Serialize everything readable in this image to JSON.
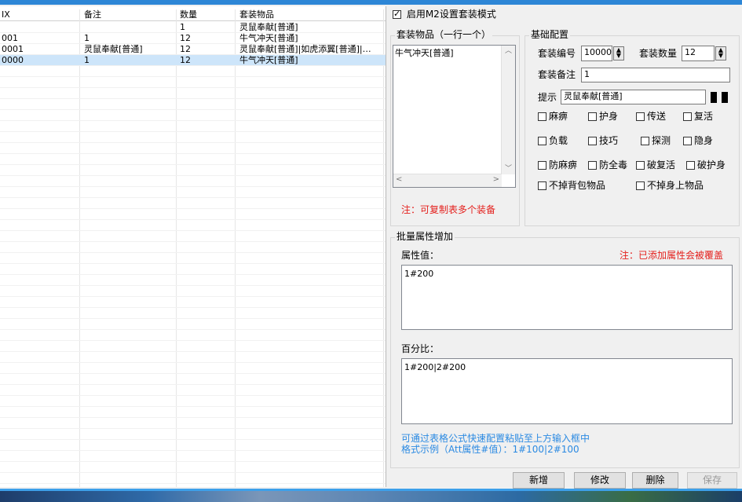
{
  "enable_mode": {
    "label": "启用M2设置套装模式",
    "checked": true
  },
  "table": {
    "columns": [
      "IX",
      "备注",
      "数量",
      "套装物品"
    ],
    "rows": [
      {
        "ix": "",
        "note": "",
        "qty": "1",
        "items": "灵鼠奉献[普通]",
        "selected": false
      },
      {
        "ix": "001",
        "note": "1",
        "qty": "12",
        "items": "牛气冲天[普通]",
        "selected": false
      },
      {
        "ix": "0001",
        "note": "灵鼠奉献[普通]",
        "qty": "12",
        "items": "灵鼠奉献[普通]|如虎添翼[普通]|…",
        "selected": false
      },
      {
        "ix": "0000",
        "note": "1",
        "qty": "12",
        "items": "牛气冲天[普通]",
        "selected": true
      }
    ]
  },
  "suit_items": {
    "legend": "套装物品（一行一个）",
    "content": "牛气冲天[普通]",
    "note": "注：可复制表多个装备"
  },
  "basic": {
    "legend": "基础配置",
    "id_label": "套装编号",
    "id_value": "10000",
    "count_label": "套装数量",
    "count_value": "12",
    "remark_label": "套装备注",
    "remark_value": "1",
    "hint_label": "提示",
    "hint_value": "灵鼠奉献[普通]",
    "options": [
      {
        "label": "麻痹",
        "checked": false
      },
      {
        "label": "护身",
        "checked": false
      },
      {
        "label": "传送",
        "checked": false
      },
      {
        "label": "复活",
        "checked": false
      },
      {
        "label": "负载",
        "checked": false
      },
      {
        "label": "技巧",
        "checked": false
      },
      {
        "label": "探测",
        "checked": false
      },
      {
        "label": "隐身",
        "checked": false
      },
      {
        "label": "防麻痹",
        "checked": false
      },
      {
        "label": "防全毒",
        "checked": false
      },
      {
        "label": "破复活",
        "checked": false
      },
      {
        "label": "破护身",
        "checked": false
      },
      {
        "label": "不掉背包物品",
        "checked": false
      },
      {
        "label": "不掉身上物品",
        "checked": false
      }
    ]
  },
  "batch": {
    "legend": "批量属性增加",
    "attr_label": "属性值：",
    "attr_warning": "注：已添加属性会被覆盖",
    "attr_value": "1#200",
    "pct_label": "百分比：",
    "pct_value": "1#200|2#200",
    "help_line1": "可通过表格公式快速配置粘贴至上方输入框中",
    "help_line2": "格式示例（Att属性#值）：1#100|2#100"
  },
  "buttons": {
    "add": "新增",
    "modify": "修改",
    "delete": "删除",
    "save": "保存"
  },
  "colors": {
    "accent": "#2d86d6",
    "warning": "#e4201d",
    "help": "#2b8ae2",
    "selection": "#cde5fa"
  }
}
